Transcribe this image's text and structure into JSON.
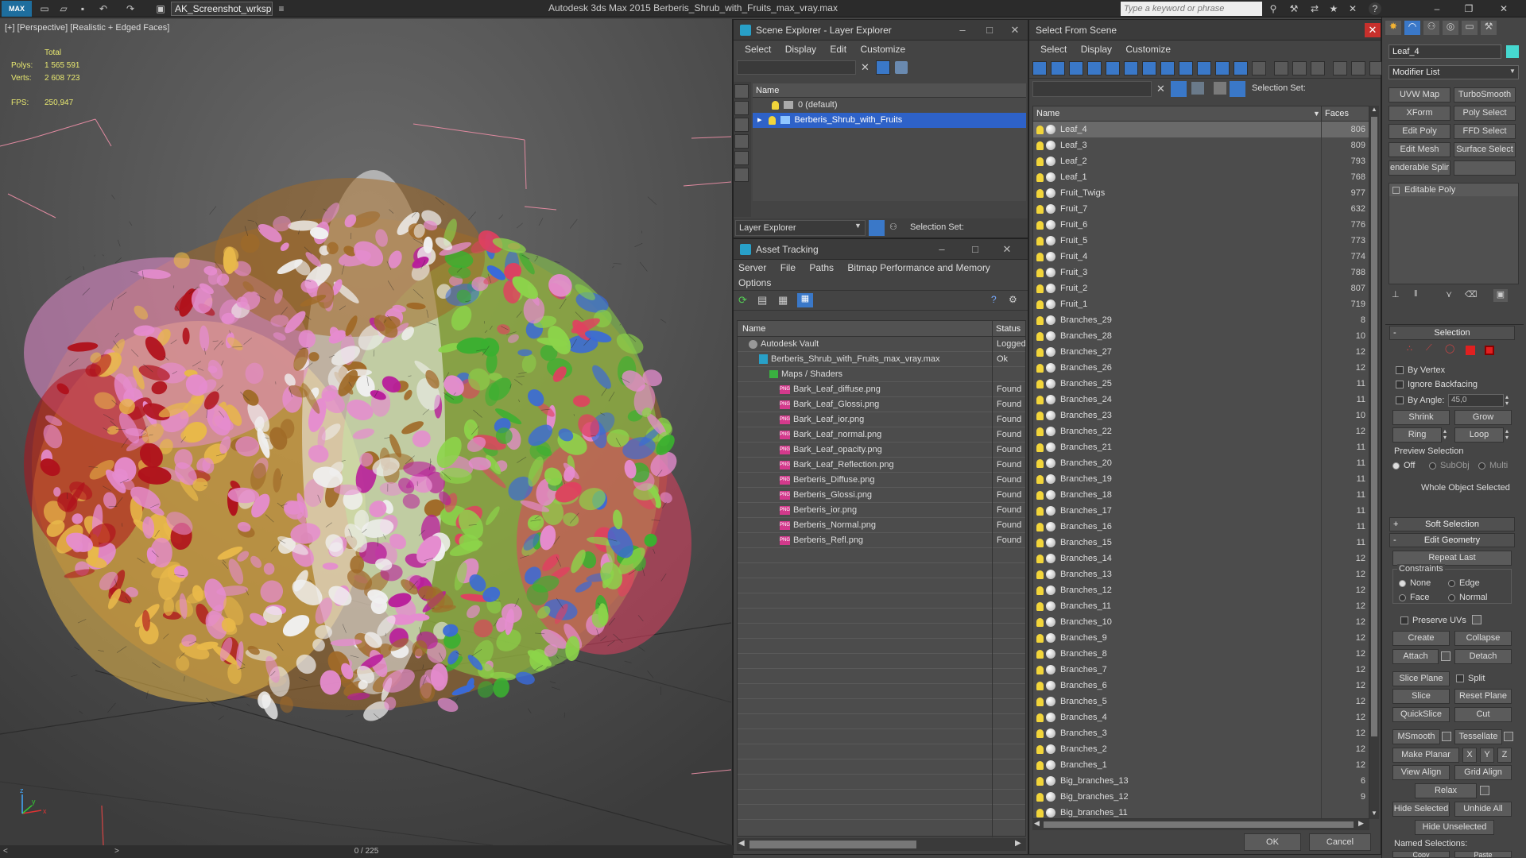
{
  "app": {
    "title": "Autodesk 3ds Max  2015     Berberis_Shrub_with_Fruits_max_vray.max",
    "logo": "MAX",
    "workspace": "AK_Screenshot_wrksp",
    "search_placeholder": "Type a keyword or phrase"
  },
  "viewport": {
    "label": "[+] [Perspective] [Realistic + Edged Faces]",
    "stats_header": "Total",
    "polys_label": "Polys:",
    "polys_value": "1 565 591",
    "verts_label": "Verts:",
    "verts_value": "2 608 723",
    "fps_label": "FPS:",
    "fps_value": "250,947",
    "timeline": "0 / 225",
    "axis_x": "x",
    "axis_y": "y",
    "axis_z": "z"
  },
  "scene_explorer": {
    "title": "Scene Explorer - Layer Explorer",
    "menus": [
      "Select",
      "Display",
      "Edit",
      "Customize"
    ],
    "column": "Name",
    "layers": [
      {
        "name": "0 (default)",
        "selected": false
      },
      {
        "name": "Berberis_Shrub_with_Fruits",
        "selected": true
      }
    ],
    "footer_combo": "Layer Explorer",
    "selection_set_label": "Selection Set:"
  },
  "asset_tracking": {
    "title": "Asset Tracking",
    "menus": [
      "Server",
      "File",
      "Paths",
      "Bitmap Performance and Memory"
    ],
    "menus2": [
      "Options"
    ],
    "columns": [
      "Name",
      "Status"
    ],
    "rows": [
      {
        "name": "Autodesk Vault",
        "status": "Logged",
        "indent": 0,
        "icon": "vault"
      },
      {
        "name": "Berberis_Shrub_with_Fruits_max_vray.max",
        "status": "Ok",
        "indent": 1,
        "icon": "max"
      },
      {
        "name": "Maps / Shaders",
        "status": "",
        "indent": 2,
        "icon": "maps"
      },
      {
        "name": "Bark_Leaf_diffuse.png",
        "status": "Found",
        "indent": 3,
        "icon": "png"
      },
      {
        "name": "Bark_Leaf_Glossi.png",
        "status": "Found",
        "indent": 3,
        "icon": "png"
      },
      {
        "name": "Bark_Leaf_ior.png",
        "status": "Found",
        "indent": 3,
        "icon": "png"
      },
      {
        "name": "Bark_Leaf_normal.png",
        "status": "Found",
        "indent": 3,
        "icon": "png"
      },
      {
        "name": "Bark_Leaf_opacity.png",
        "status": "Found",
        "indent": 3,
        "icon": "png"
      },
      {
        "name": "Bark_Leaf_Reflection.png",
        "status": "Found",
        "indent": 3,
        "icon": "png"
      },
      {
        "name": "Berberis_Diffuse.png",
        "status": "Found",
        "indent": 3,
        "icon": "png"
      },
      {
        "name": "Berberis_Glossi.png",
        "status": "Found",
        "indent": 3,
        "icon": "png"
      },
      {
        "name": "Berberis_ior.png",
        "status": "Found",
        "indent": 3,
        "icon": "png"
      },
      {
        "name": "Berberis_Normal.png",
        "status": "Found",
        "indent": 3,
        "icon": "png"
      },
      {
        "name": "Berberis_Refl.png",
        "status": "Found",
        "indent": 3,
        "icon": "png"
      }
    ]
  },
  "select_from_scene": {
    "title": "Select From Scene",
    "menus": [
      "Select",
      "Display",
      "Customize"
    ],
    "selection_set_label": "Selection Set:",
    "columns": [
      "Name",
      "Faces"
    ],
    "rows": [
      {
        "name": "Leaf_4",
        "faces": "806",
        "selected": true
      },
      {
        "name": "Leaf_3",
        "faces": "809"
      },
      {
        "name": "Leaf_2",
        "faces": "793"
      },
      {
        "name": "Leaf_1",
        "faces": "768"
      },
      {
        "name": "Fruit_Twigs",
        "faces": "977"
      },
      {
        "name": "Fruit_7",
        "faces": "632"
      },
      {
        "name": "Fruit_6",
        "faces": "776"
      },
      {
        "name": "Fruit_5",
        "faces": "773"
      },
      {
        "name": "Fruit_4",
        "faces": "774"
      },
      {
        "name": "Fruit_3",
        "faces": "788"
      },
      {
        "name": "Fruit_2",
        "faces": "807"
      },
      {
        "name": "Fruit_1",
        "faces": "719"
      },
      {
        "name": "Branches_29",
        "faces": "8"
      },
      {
        "name": "Branches_28",
        "faces": "10"
      },
      {
        "name": "Branches_27",
        "faces": "12"
      },
      {
        "name": "Branches_26",
        "faces": "12"
      },
      {
        "name": "Branches_25",
        "faces": "11"
      },
      {
        "name": "Branches_24",
        "faces": "11"
      },
      {
        "name": "Branches_23",
        "faces": "10"
      },
      {
        "name": "Branches_22",
        "faces": "12"
      },
      {
        "name": "Branches_21",
        "faces": "11"
      },
      {
        "name": "Branches_20",
        "faces": "11"
      },
      {
        "name": "Branches_19",
        "faces": "11"
      },
      {
        "name": "Branches_18",
        "faces": "11"
      },
      {
        "name": "Branches_17",
        "faces": "11"
      },
      {
        "name": "Branches_16",
        "faces": "11"
      },
      {
        "name": "Branches_15",
        "faces": "11"
      },
      {
        "name": "Branches_14",
        "faces": "12"
      },
      {
        "name": "Branches_13",
        "faces": "12"
      },
      {
        "name": "Branches_12",
        "faces": "12"
      },
      {
        "name": "Branches_11",
        "faces": "12"
      },
      {
        "name": "Branches_10",
        "faces": "12"
      },
      {
        "name": "Branches_9",
        "faces": "12"
      },
      {
        "name": "Branches_8",
        "faces": "12"
      },
      {
        "name": "Branches_7",
        "faces": "12"
      },
      {
        "name": "Branches_6",
        "faces": "12"
      },
      {
        "name": "Branches_5",
        "faces": "12"
      },
      {
        "name": "Branches_4",
        "faces": "12"
      },
      {
        "name": "Branches_3",
        "faces": "12"
      },
      {
        "name": "Branches_2",
        "faces": "12"
      },
      {
        "name": "Branches_1",
        "faces": "12"
      },
      {
        "name": "Big_branches_13",
        "faces": "6"
      },
      {
        "name": "Big_branches_12",
        "faces": "9"
      },
      {
        "name": "Big_branches_11",
        "faces": ""
      }
    ],
    "ok": "OK",
    "cancel": "Cancel"
  },
  "command_panel": {
    "object_name": "Leaf_4",
    "modifier_list": "Modifier List",
    "modifier_buttons": [
      "UVW Map",
      "TurboSmooth",
      "XForm",
      "Poly Select",
      "Edit Poly",
      "FFD Select",
      "Edit Mesh",
      "Surface Select",
      "enderable Splir",
      ""
    ],
    "stack_item": "Editable Poly",
    "selection": {
      "header": "Selection",
      "by_vertex": "By Vertex",
      "ignore_backfacing": "Ignore Backfacing",
      "by_angle": "By Angle:",
      "angle_value": "45,0",
      "shrink": "Shrink",
      "grow": "Grow",
      "ring": "Ring",
      "loop": "Loop",
      "preview_selection": "Preview Selection",
      "preview_off": "Off",
      "preview_subobj": "SubObj",
      "preview_multi": "Multi",
      "status": "Whole Object Selected"
    },
    "soft_selection": "Soft Selection",
    "edit_geometry": {
      "header": "Edit Geometry",
      "repeat_last": "Repeat Last",
      "constraints": "Constraints",
      "none": "None",
      "edge": "Edge",
      "face": "Face",
      "normal": "Normal",
      "preserve_uvs": "Preserve UVs",
      "create": "Create",
      "collapse": "Collapse",
      "attach": "Attach",
      "detach": "Detach",
      "slice_plane": "Slice Plane",
      "split": "Split",
      "slice": "Slice",
      "reset_plane": "Reset Plane",
      "quickslice": "QuickSlice",
      "cut": "Cut",
      "msmooth": "MSmooth",
      "tessellate": "Tessellate",
      "make_planar": "Make Planar",
      "x": "X",
      "y": "Y",
      "z": "Z",
      "view_align": "View Align",
      "grid_align": "Grid Align",
      "relax": "Relax",
      "hide_selected": "Hide Selected",
      "unhide_all": "Unhide All",
      "hide_unselected": "Hide Unselected",
      "named_selections": "Named Selections:",
      "copy": "Copy",
      "paste": "Paste"
    }
  },
  "colors": {
    "selection_blue": "#2e62c8",
    "bulb": "#f2d53a",
    "png_icon": "#d33a8c",
    "foliage": [
      "#e58ccf",
      "#e8b84a",
      "#b0121c",
      "#8cd44a",
      "#f0f0f0",
      "#a06a28",
      "#e04060",
      "#3a6ad8",
      "#b81d9a",
      "#3ab030"
    ]
  }
}
